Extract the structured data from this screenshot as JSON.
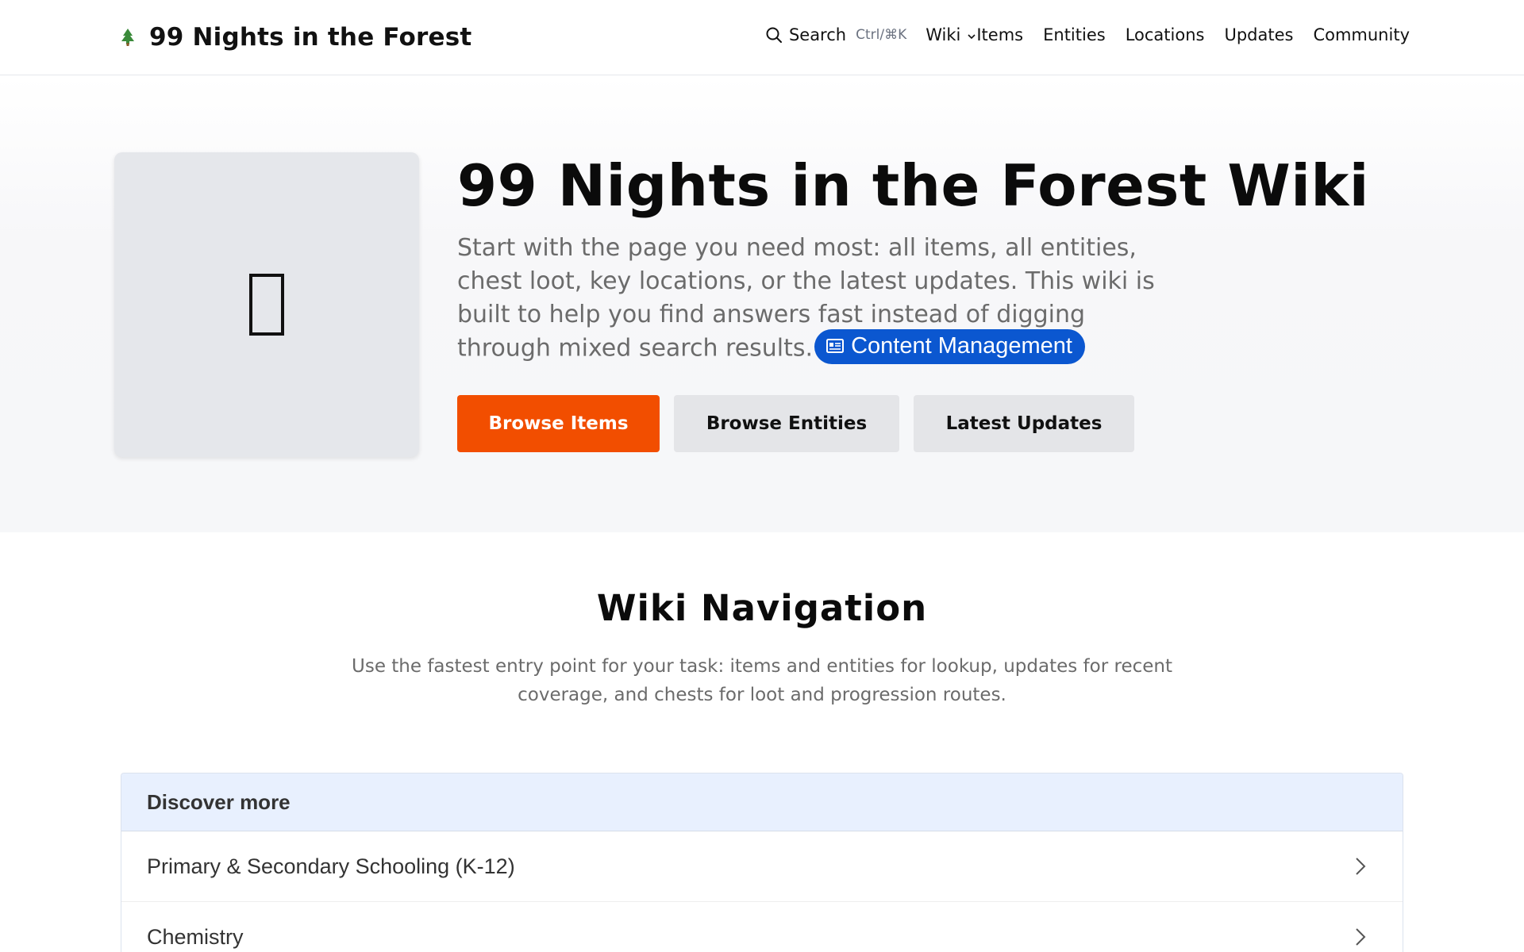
{
  "header": {
    "brand_name": "99 Nights in the Forest",
    "brand_icon": "pine-tree-icon",
    "search_label": "Search",
    "search_shortcut": "Ctrl/⌘K",
    "nav": {
      "wiki": "Wiki",
      "items": "Items",
      "entities": "Entities",
      "locations": "Locations",
      "updates": "Updates",
      "community": "Community"
    }
  },
  "hero": {
    "title": "99 Nights in the Forest Wiki",
    "description": "Start with the page you need most: all items, all entities, chest loot, key locations, or the latest updates. This wiki is built to help you find answers fast instead of digging through mixed search results.",
    "badge_label": "Content Management",
    "badge_icon": "newspaper-icon",
    "buttons": {
      "browse_items": "Browse Items",
      "browse_entities": "Browse Entities",
      "latest_updates": "Latest Updates"
    }
  },
  "navigation_section": {
    "title": "Wiki Navigation",
    "description": "Use the fastest entry point for your task: items and entities for lookup, updates for recent coverage, and chests for loot and progression routes."
  },
  "discover": {
    "heading": "Discover more",
    "items": [
      {
        "label": "Primary & Secondary Schooling (K-12)"
      },
      {
        "label": "Chemistry"
      }
    ]
  },
  "colors": {
    "primary_button": "#f24e00",
    "badge": "#0b57d0",
    "discover_header": "#e8f0fe"
  }
}
